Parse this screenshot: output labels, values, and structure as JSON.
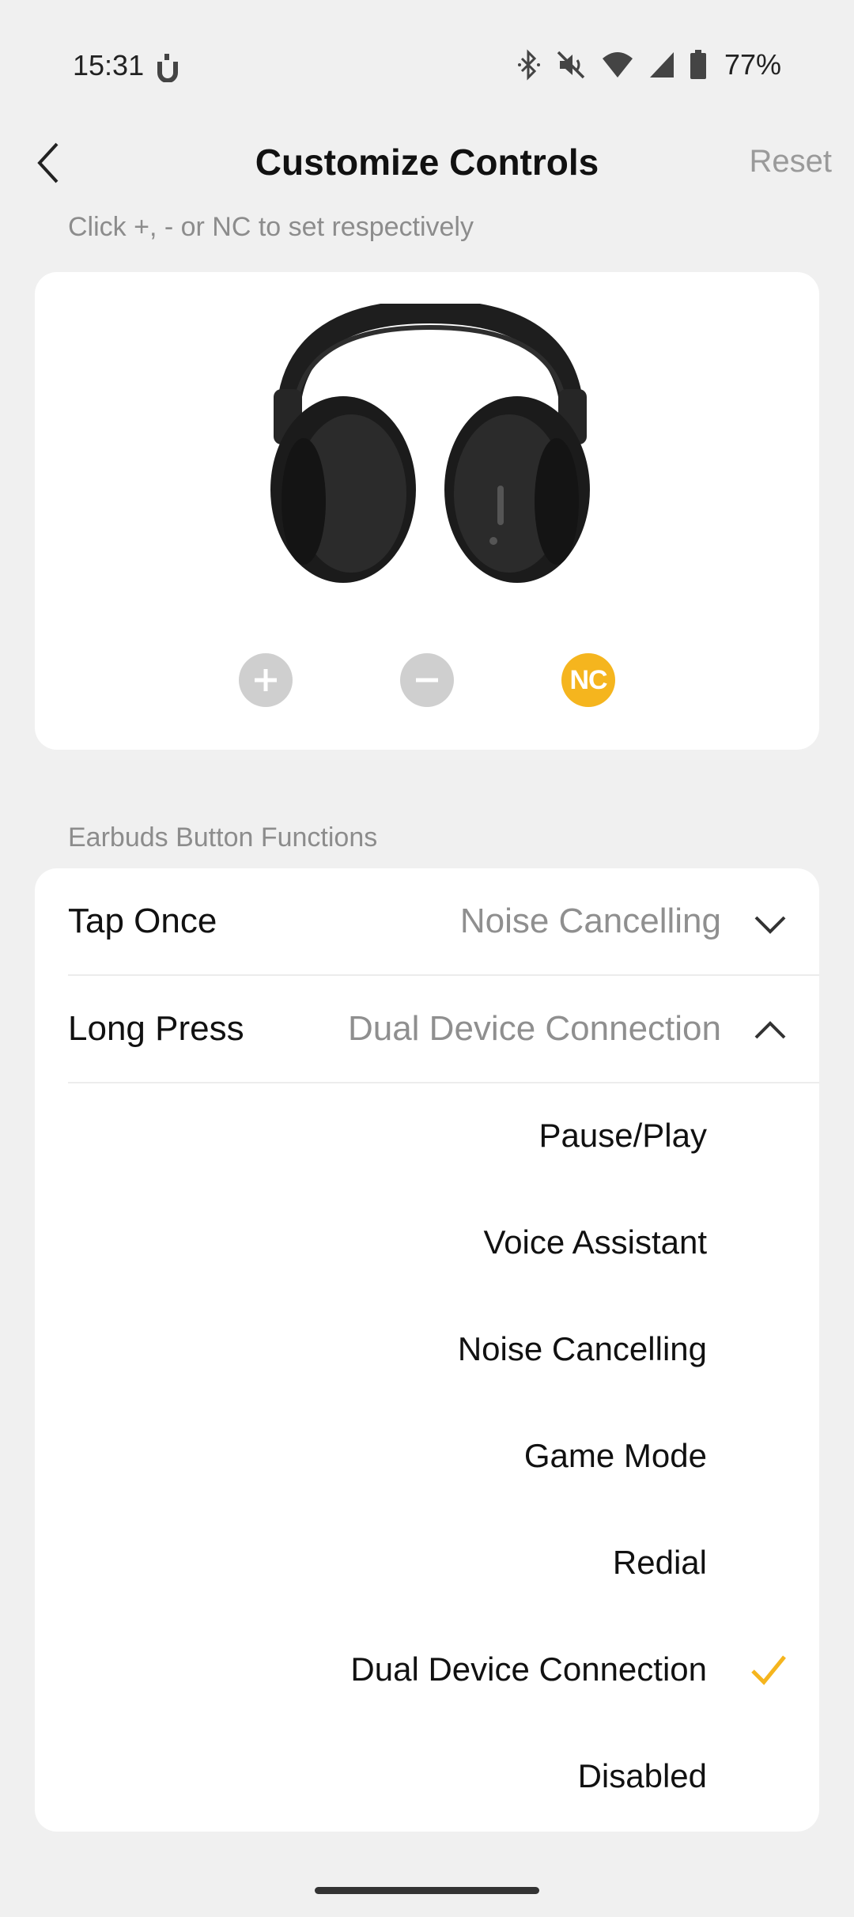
{
  "status_bar": {
    "time": "15:31",
    "battery_percent": "77%",
    "icons": [
      "app-u-icon",
      "bluetooth-icon",
      "mute-icon",
      "wifi-icon",
      "signal-icon",
      "battery-icon"
    ]
  },
  "header": {
    "title": "Customize Controls",
    "reset_label": "Reset",
    "back_icon": "chevron-left-icon"
  },
  "hint": "Click +, - or NC to set respectively",
  "device_card": {
    "image": "headphones-image",
    "controls": {
      "plus_icon": "plus-icon",
      "minus_icon": "minus-icon",
      "nc_label": "NC"
    },
    "colors": {
      "nc_accent": "#f5b51e",
      "inactive_control": "#cfcfcf"
    }
  },
  "section_label": "Earbuds Button Functions",
  "functions": [
    {
      "name": "Tap Once",
      "value": "Noise Cancelling",
      "expanded": false
    },
    {
      "name": "Long Press",
      "value": "Dual Device Connection",
      "expanded": true
    }
  ],
  "options": [
    {
      "label": "Pause/Play",
      "selected": false
    },
    {
      "label": "Voice Assistant",
      "selected": false
    },
    {
      "label": "Noise Cancelling",
      "selected": false
    },
    {
      "label": "Game Mode",
      "selected": false
    },
    {
      "label": "Redial",
      "selected": false
    },
    {
      "label": "Dual Device Connection",
      "selected": true
    },
    {
      "label": "Disabled",
      "selected": false
    }
  ],
  "accent_color": "#f5b51e"
}
